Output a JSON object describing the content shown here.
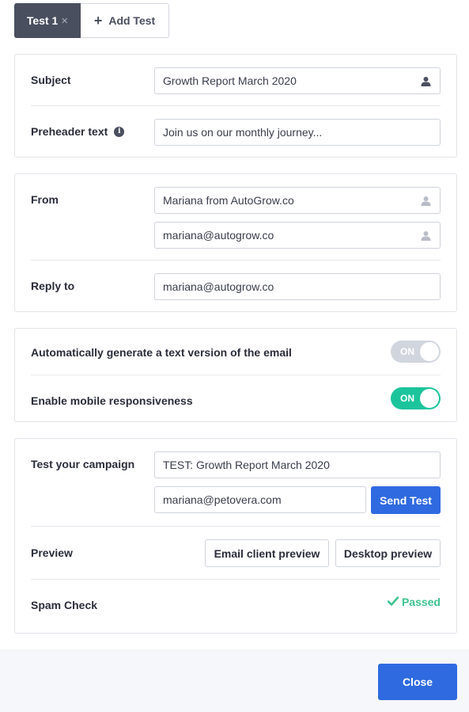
{
  "tabs": {
    "active_label": "Test 1",
    "close_glyph": "×",
    "add_label": "Add Test"
  },
  "subject_card": {
    "subject_label": "Subject",
    "subject_value": "Growth Report March 2020",
    "preheader_label": "Preheader text",
    "preheader_value": "Join us on our monthly journey..."
  },
  "sender_card": {
    "from_label": "From",
    "from_name": "Mariana from AutoGrow.co",
    "from_email": "mariana@autogrow.co",
    "reply_label": "Reply to",
    "reply_value": "mariana@autogrow.co"
  },
  "options_card": {
    "text_version_label": "Automatically generate a text version of the email",
    "text_version_toggle": "ON",
    "mobile_label": "Enable mobile responsiveness",
    "mobile_toggle": "ON"
  },
  "test_card": {
    "test_label": "Test your campaign",
    "test_subject": "TEST: Growth Report March 2020",
    "test_email": "mariana@petovera.com",
    "send_label": "Send Test",
    "preview_label": "Preview",
    "email_preview_label": "Email client preview",
    "desktop_preview_label": "Desktop preview",
    "spam_label": "Spam Check",
    "spam_status": "Passed"
  },
  "footer": {
    "close_label": "Close"
  },
  "colors": {
    "primary": "#2f6ae0",
    "toggle_on": "#1cc49c",
    "toggle_off": "#d1d5dd",
    "passed": "#3cc48f",
    "tab_active": "#4a4f5f"
  },
  "icons": [
    "close-icon",
    "plus-icon",
    "user-icon",
    "info-icon",
    "check-icon"
  ]
}
